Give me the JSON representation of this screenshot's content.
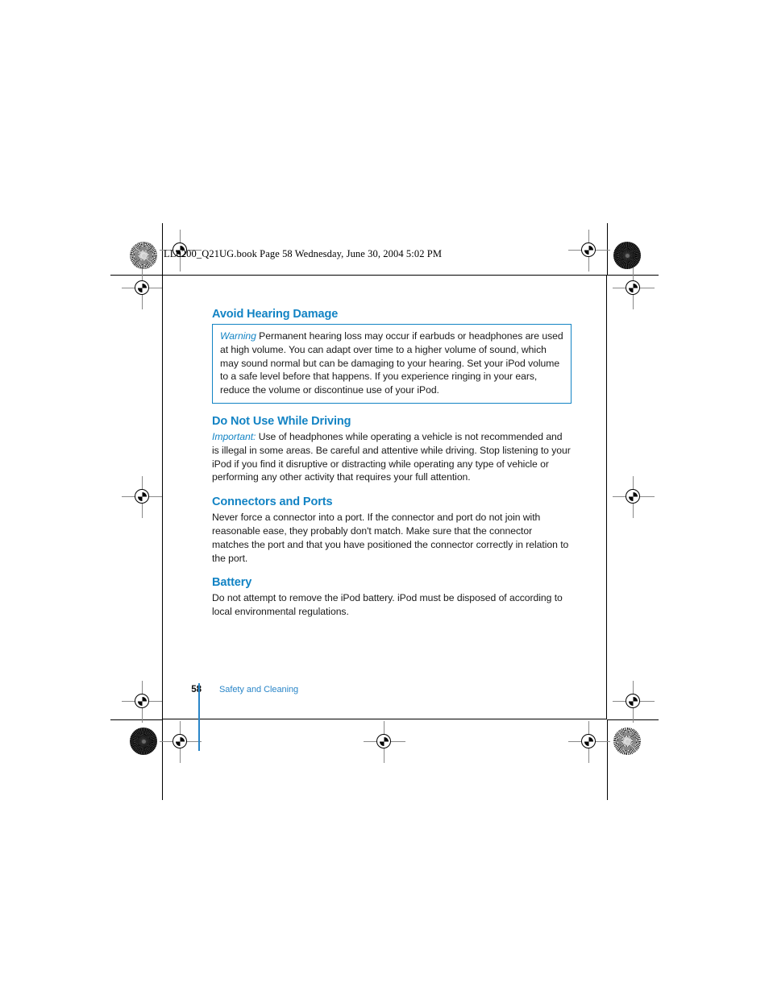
{
  "proof": {
    "header_stamp": "LL0200_Q21UG.book  Page 58  Wednesday, June 30, 2004  5:02 PM",
    "marks": {
      "registration_mark": "registration-bullseye",
      "color_target_light": "radial-starburst-target-light",
      "color_target_dark": "radial-starburst-target-dark"
    }
  },
  "colors": {
    "heading_blue": "#1283c4",
    "footer_blue": "#2a86c8",
    "body_text": "#1a1a1a",
    "frame_black": "#000000"
  },
  "page": {
    "sections": [
      {
        "heading": "Avoid Hearing Damage",
        "callout": {
          "label": "Warning",
          "text": "Permanent hearing loss may occur if earbuds or headphones are used at high volume. You can adapt over time to a higher volume of sound, which may sound normal but can be damaging to your hearing. Set your iPod volume to a safe level before that happens. If you experience ringing in your ears, reduce the volume or discontinue use of your iPod."
        }
      },
      {
        "heading": "Do Not Use While Driving",
        "label": "Important:",
        "text": "Use of headphones while operating a vehicle is not recommended and is illegal in some areas. Be careful and attentive while driving. Stop listening to your iPod if you find it disruptive or distracting while operating any type of vehicle or performing any other activity that requires your full attention."
      },
      {
        "heading": "Connectors and Ports",
        "text": "Never force a connector into a port. If the connector and port do not join with reasonable ease, they probably don't match. Make sure that the connector matches the port and that you have positioned the connector correctly in relation to the port."
      },
      {
        "heading": "Battery",
        "text": "Do not attempt to remove the iPod battery. iPod must be disposed of according to local environmental regulations."
      }
    ],
    "footer": {
      "page_number": "58",
      "chapter_title": "Safety and Cleaning"
    }
  }
}
